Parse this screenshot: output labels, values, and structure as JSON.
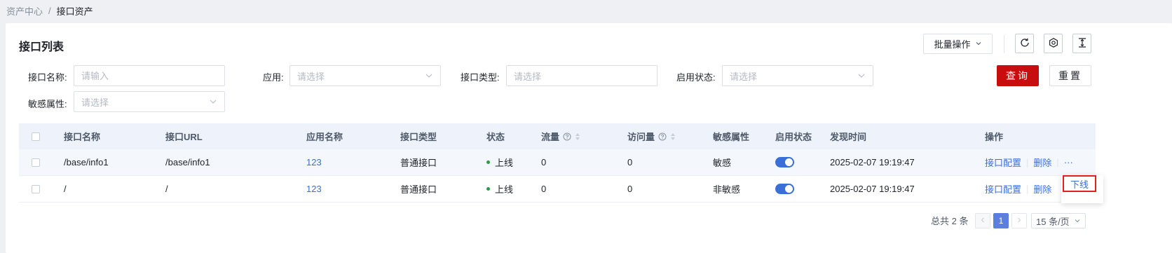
{
  "breadcrumb": {
    "parent": "资产中心",
    "separator": "/",
    "current": "接口资产"
  },
  "header": {
    "title": "接口列表",
    "batch_label": "批量操作"
  },
  "filters": {
    "name_label": "接口名称:",
    "name_placeholder": "请输入",
    "app_label": "应用:",
    "app_placeholder": "请选择",
    "type_label": "接口类型:",
    "type_placeholder": "请选择",
    "status_label": "启用状态:",
    "status_placeholder": "请选择",
    "sensitive_label": "敏感属性:",
    "sensitive_placeholder": "请选择",
    "query_label": "查询",
    "reset_label": "重置"
  },
  "table": {
    "columns": [
      "接口名称",
      "接口URL",
      "应用名称",
      "接口类型",
      "状态",
      "流量",
      "访问量",
      "敏感属性",
      "启用状态",
      "发现时间",
      "操作"
    ],
    "rows": [
      {
        "name": "/base/info1",
        "url": "/base/info1",
        "app": "123",
        "type": "普通接口",
        "status": "上线",
        "traffic": "0",
        "visits": "0",
        "sensitive": "敏感",
        "enabled": true,
        "found": "2025-02-07 19:19:47",
        "op_config": "接口配置",
        "op_delete": "删除",
        "op_more": "···"
      },
      {
        "name": "/",
        "url": "/",
        "app": "123",
        "type": "普通接口",
        "status": "上线",
        "traffic": "0",
        "visits": "0",
        "sensitive": "非敏感",
        "enabled": true,
        "found": "2025-02-07 19:19:47",
        "op_config": "接口配置",
        "op_delete": "删除"
      }
    ]
  },
  "dropdown": {
    "item": "下线"
  },
  "pagination": {
    "total": "总共 2 条",
    "current": "1",
    "page_size": "15 条/页"
  },
  "colors": {
    "primary_red": "#c70d0d",
    "link_blue": "#3b6fd8",
    "status_green": "#2b9a4a"
  }
}
